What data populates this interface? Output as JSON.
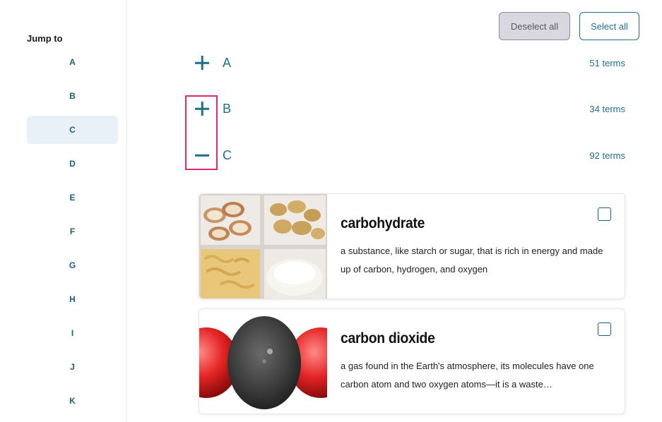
{
  "sidebar": {
    "title": "Jump to",
    "letters": [
      "A",
      "B",
      "C",
      "D",
      "E",
      "F",
      "G",
      "H",
      "I",
      "J",
      "K"
    ],
    "active_letter": "C"
  },
  "toolbar": {
    "deselect_label": "Deselect all",
    "select_label": "Select all"
  },
  "sections": [
    {
      "letter": "A",
      "count": "51 terms",
      "expanded": false
    },
    {
      "letter": "B",
      "count": "34 terms",
      "expanded": false
    },
    {
      "letter": "C",
      "count": "92 terms",
      "expanded": true
    }
  ],
  "cards": [
    {
      "title": "carbohydrate",
      "description": "a substance, like starch or sugar, that is rich in energy and made up of carbon, hydrogen, and oxygen",
      "checked": false
    },
    {
      "title": "carbon dioxide",
      "description": "a gas found in the Earth's atmosphere, its molecules have one carbon atom and two oxygen atoms—it is a waste…",
      "checked": false
    }
  ],
  "colors": {
    "accent": "#1f6f8b",
    "highlight": "#e0287a",
    "active_bg": "#e7f1f7"
  }
}
